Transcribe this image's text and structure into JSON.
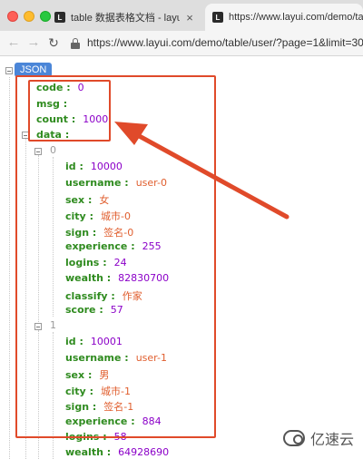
{
  "browser": {
    "tabs": [
      {
        "title": "table 数据表格文档 - layui",
        "favicon": "L"
      },
      {
        "title": "https://www.layui.com/demo/ta",
        "favicon": "L"
      }
    ],
    "url": "https://www.layui.com/demo/table/user/?page=1&limit=30"
  },
  "json_view": {
    "root_label": "JSON",
    "fields": [
      {
        "key": "code",
        "value": "0",
        "kind": "num"
      },
      {
        "key": "msg",
        "value": "",
        "kind": "str"
      },
      {
        "key": "count",
        "value": "1000",
        "kind": "num"
      },
      {
        "key": "data",
        "value": "",
        "kind": "obj"
      }
    ],
    "items": [
      {
        "index": "0",
        "fields": [
          {
            "key": "id",
            "value": "10000",
            "kind": "num"
          },
          {
            "key": "username",
            "value": "user-0",
            "kind": "str"
          },
          {
            "key": "sex",
            "value": "女",
            "kind": "str"
          },
          {
            "key": "city",
            "value": "城市-0",
            "kind": "str"
          },
          {
            "key": "sign",
            "value": "签名-0",
            "kind": "str"
          },
          {
            "key": "experience",
            "value": "255",
            "kind": "num"
          },
          {
            "key": "logins",
            "value": "24",
            "kind": "num"
          },
          {
            "key": "wealth",
            "value": "82830700",
            "kind": "num"
          },
          {
            "key": "classify",
            "value": "作家",
            "kind": "str"
          },
          {
            "key": "score",
            "value": "57",
            "kind": "num"
          }
        ]
      },
      {
        "index": "1",
        "fields": [
          {
            "key": "id",
            "value": "10001",
            "kind": "num"
          },
          {
            "key": "username",
            "value": "user-1",
            "kind": "str"
          },
          {
            "key": "sex",
            "value": "男",
            "kind": "str"
          },
          {
            "key": "city",
            "value": "城市-1",
            "kind": "str"
          },
          {
            "key": "sign",
            "value": "签名-1",
            "kind": "str"
          },
          {
            "key": "experience",
            "value": "884",
            "kind": "num"
          },
          {
            "key": "logins",
            "value": "58",
            "kind": "num"
          },
          {
            "key": "wealth",
            "value": "64928690",
            "kind": "num"
          }
        ]
      }
    ]
  },
  "watermark": {
    "text": "亿速云"
  },
  "colors": {
    "key": "#2f8b1f",
    "number": "#8b00c8",
    "string": "#e05e2e",
    "annotation": "#e04a2a",
    "badge": "#4b86d8"
  }
}
